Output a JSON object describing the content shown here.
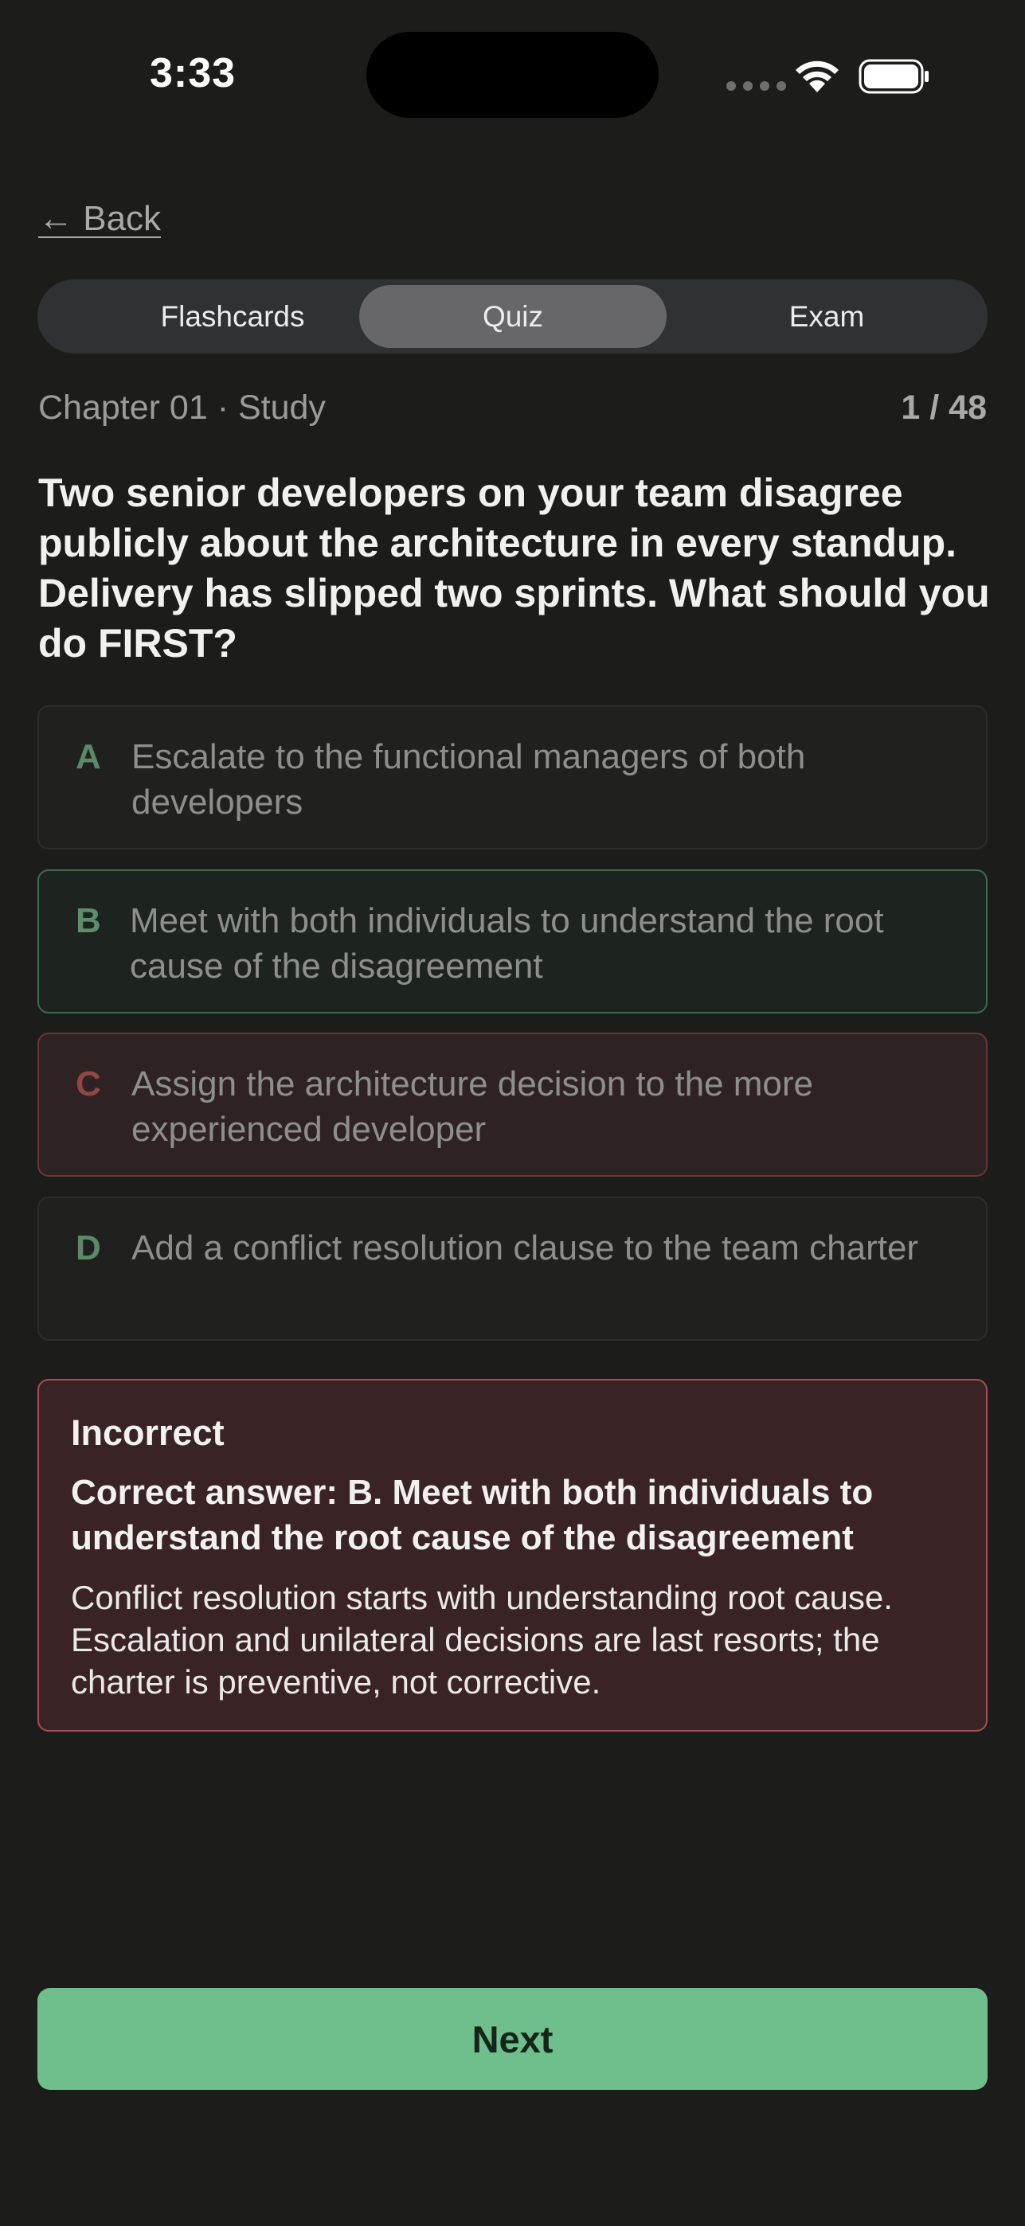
{
  "status_bar": {
    "time": "3:33"
  },
  "nav": {
    "back_label": "← Back"
  },
  "tabs": [
    {
      "label": "Flashcards",
      "selected": false
    },
    {
      "label": "Quiz",
      "selected": true
    },
    {
      "label": "Exam",
      "selected": false
    }
  ],
  "meta": {
    "chapter": "Chapter 01 · Study",
    "progress": "1 / 48"
  },
  "question": "Two senior developers on your team disagree publicly about the architecture in every standup. Delivery has slipped two sprints. What should you do FIRST?",
  "options": [
    {
      "letter": "A",
      "text": "Escalate to the functional managers of both developers",
      "state": "neutral"
    },
    {
      "letter": "B",
      "text": "Meet with both individuals to understand the root cause of the disagreement",
      "state": "correct"
    },
    {
      "letter": "C",
      "text": "Assign the architecture decision to the more experienced developer",
      "state": "selected-wrong"
    },
    {
      "letter": "D",
      "text": "Add a conflict resolution clause to the team charter",
      "state": "neutral"
    }
  ],
  "feedback": {
    "title": "Incorrect",
    "correct_answer": "Correct answer: B. Meet with both individuals to understand the root cause of the disagreement",
    "explanation": "Conflict resolution starts with understanding root cause. Escalation and unilateral decisions are last resorts; the charter is preventive, not corrective."
  },
  "next_label": "Next",
  "colors": {
    "background": "#1c1d1b",
    "accent_green": "#6ebf8b",
    "error_red": "#a84e54"
  }
}
